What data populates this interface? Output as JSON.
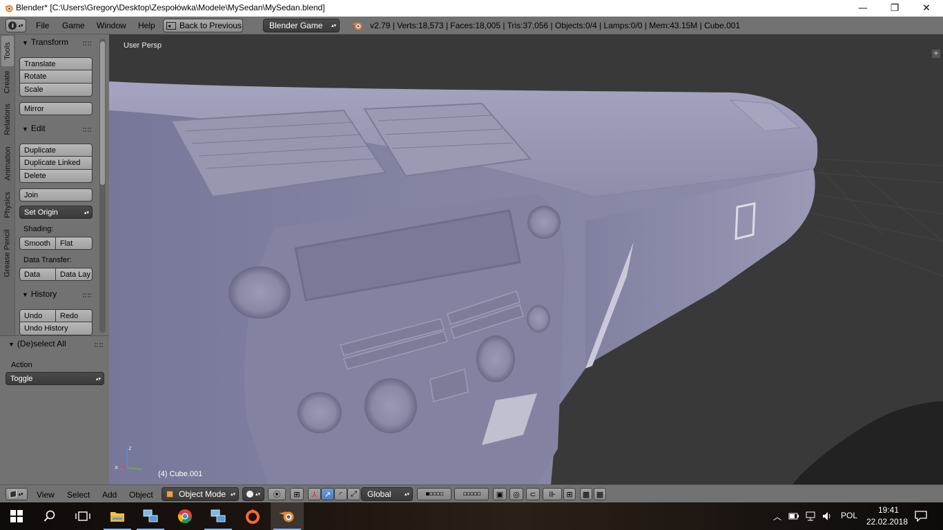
{
  "window": {
    "title": "Blender* [C:\\Users\\Gregory\\Desktop\\Zespołówka\\Modele\\MySedan\\MySedan.blend]",
    "minimize": "—",
    "maximize": "❐",
    "close": "✕"
  },
  "infobar": {
    "menus": [
      "File",
      "Game",
      "Window",
      "Help"
    ],
    "back_label": "Back to Previous",
    "engine": "Blender Game",
    "stats": "v2.79 | Verts:18,573 | Faces:18,005 | Tris:37,056 | Objects:0/4 | Lamps:0/0 | Mem:43.15M | Cube.001"
  },
  "tabs": [
    "Tools",
    "Create",
    "Relations",
    "Animation",
    "Physics",
    "Grease Pencil"
  ],
  "toolshelf": {
    "transform": {
      "title": "Transform",
      "translate": "Translate",
      "rotate": "Rotate",
      "scale": "Scale",
      "mirror": "Mirror"
    },
    "edit": {
      "title": "Edit",
      "duplicate": "Duplicate",
      "duplicate_linked": "Duplicate Linked",
      "delete": "Delete",
      "join": "Join",
      "set_origin": "Set Origin",
      "shading_label": "Shading:",
      "smooth": "Smooth",
      "flat": "Flat",
      "data_transfer_label": "Data Transfer:",
      "data": "Data",
      "data_lay": "Data Lay"
    },
    "history": {
      "title": "History",
      "undo": "Undo",
      "redo": "Redo",
      "undo_history": "Undo History"
    }
  },
  "operator": {
    "title": "(De)select All",
    "action_label": "Action",
    "action_value": "Toggle"
  },
  "viewport": {
    "view_label": "User Persp",
    "object_label": "(4) Cube.001",
    "axis_z": "z",
    "axis_x": "x"
  },
  "view3d_header": {
    "menus": [
      "View",
      "Select",
      "Add",
      "Object"
    ],
    "mode": "Object Mode",
    "orientation": "Global"
  },
  "taskbar": {
    "language": "POL",
    "time": "19:41",
    "date": "22.02.2018"
  },
  "colors": {
    "ui_gray": "#727272",
    "viewport_bg": "#393939",
    "mesh": "#8a8aa6",
    "active_blue": "#5680c2"
  }
}
